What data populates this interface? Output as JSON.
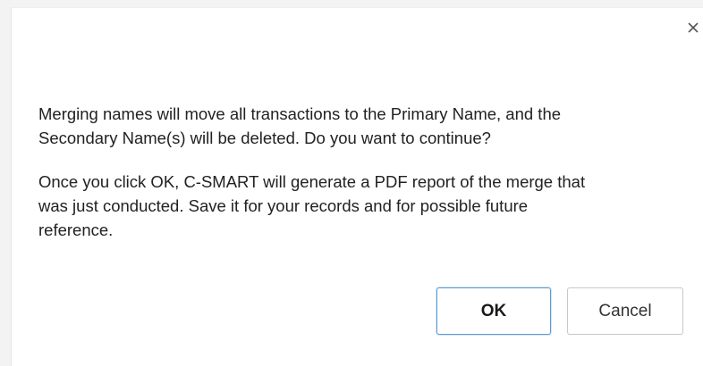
{
  "dialog": {
    "close_icon": "close-icon",
    "messages": [
      "Merging names will move all transactions to the Primary Name, and the\nSecondary Name(s) will be deleted. Do you want to continue?",
      "Once you click OK, C-SMART will generate a PDF report of the merge that\nwas just conducted. Save it for your records and for possible future\nreference."
    ],
    "buttons": {
      "ok_label": "OK",
      "cancel_label": "Cancel"
    },
    "colors": {
      "ok_border": "#5b9bd5",
      "cancel_border": "#c8c8c8",
      "background": "#ffffff"
    }
  }
}
